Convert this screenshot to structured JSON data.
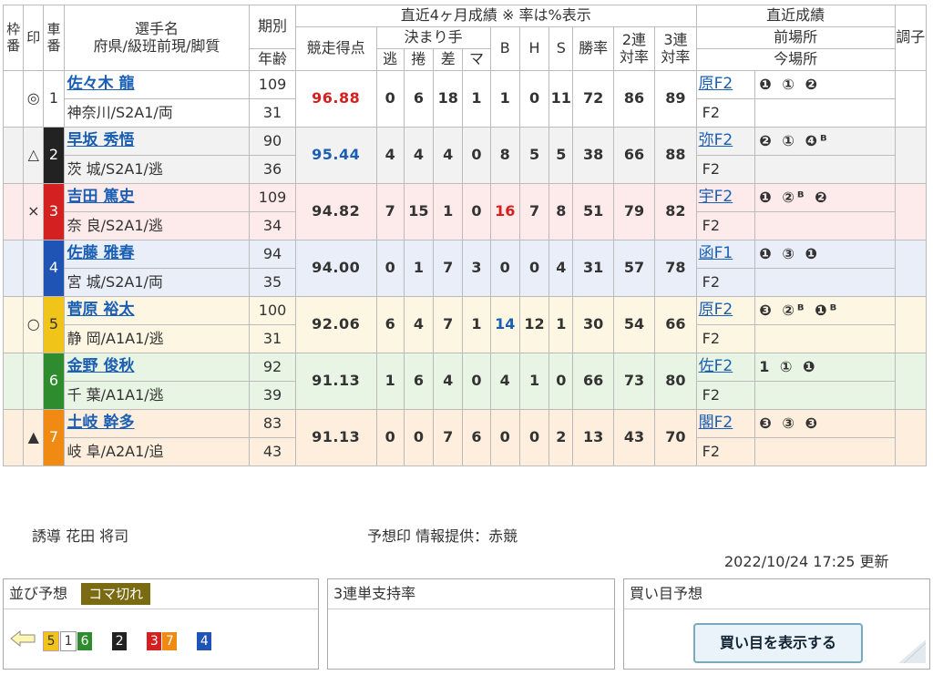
{
  "header": {
    "waku": "枠番",
    "shirushi": "印",
    "sha": "車番",
    "name1": "選手名",
    "name2": "府県/級班前現/脚質",
    "kibetsu": "期別",
    "nenrei": "年齢",
    "recent_title": "直近4ヶ月成績 ※ 率は%表示",
    "score": "競走得点",
    "kimarite": "決まり手",
    "nige": "逃",
    "makuri": "捲",
    "sashi": "差",
    "ma": "マ",
    "b": "B",
    "h": "H",
    "s": "S",
    "win": "勝率",
    "ren2": "2連\n対率",
    "ren3": "3連\n対率",
    "recent_results": "直近成績",
    "prev_venue": "前場所",
    "now_venue": "今場所",
    "chousi": "調子"
  },
  "riders": [
    {
      "mark": "◎",
      "car": "1",
      "name": "佐々木 龍",
      "info": "神奈川/S2A1/両",
      "ki": "109",
      "age": "31",
      "score": "96.88",
      "nige": "0",
      "makuri": "6",
      "sashi": "18",
      "ma": "1",
      "b": "1",
      "h": "0",
      "s": "11",
      "win": "72",
      "ren2": "86",
      "ren3": "89",
      "prev": "原F2",
      "results": "❶ ① ❷",
      "now": "F2"
    },
    {
      "mark": "△",
      "car": "2",
      "name": "早坂 秀悟",
      "info": "茨 城/S2A1/逃",
      "ki": "90",
      "age": "36",
      "score": "95.44",
      "nige": "4",
      "makuri": "4",
      "sashi": "4",
      "ma": "0",
      "b": "8",
      "h": "5",
      "s": "5",
      "win": "38",
      "ren2": "66",
      "ren3": "88",
      "prev": "弥F2",
      "results": "❷ ① ❹ᴮ",
      "now": "F2"
    },
    {
      "mark": "×",
      "car": "3",
      "name": "吉田 篤史",
      "info": "奈 良/S2A1/逃",
      "ki": "109",
      "age": "34",
      "score": "94.82",
      "nige": "7",
      "makuri": "15",
      "sashi": "1",
      "ma": "0",
      "b": "16",
      "h": "7",
      "s": "8",
      "win": "51",
      "ren2": "79",
      "ren3": "82",
      "prev": "宇F2",
      "results": "❶ ②ᴮ ❷",
      "now": "F2"
    },
    {
      "mark": "",
      "car": "4",
      "name": "佐藤 雅春",
      "info": "宮 城/S2A1/両",
      "ki": "94",
      "age": "35",
      "score": "94.00",
      "nige": "0",
      "makuri": "1",
      "sashi": "7",
      "ma": "3",
      "b": "0",
      "h": "0",
      "s": "4",
      "win": "31",
      "ren2": "57",
      "ren3": "78",
      "prev": "函F1",
      "results": "❶ ③ ❶",
      "now": "F2"
    },
    {
      "mark": "○",
      "car": "5",
      "name": "菅原 裕太",
      "info": "静 岡/A1A1/逃",
      "ki": "100",
      "age": "31",
      "score": "92.06",
      "nige": "6",
      "makuri": "4",
      "sashi": "7",
      "ma": "1",
      "b": "14",
      "h": "12",
      "s": "1",
      "win": "30",
      "ren2": "54",
      "ren3": "66",
      "prev": "原F2",
      "results": "❸ ②ᴮ ❶ᴮ",
      "now": "F2"
    },
    {
      "mark": "",
      "car": "6",
      "name": "金野 俊秋",
      "info": "千 葉/A1A1/逃",
      "ki": "92",
      "age": "39",
      "score": "91.13",
      "nige": "1",
      "makuri": "6",
      "sashi": "4",
      "ma": "0",
      "b": "4",
      "h": "1",
      "s": "0",
      "win": "66",
      "ren2": "73",
      "ren3": "80",
      "prev": "佐F2",
      "results": "1 ① ❶",
      "now": "F2"
    },
    {
      "mark": "▲",
      "car": "7",
      "name": "土岐 幹多",
      "info": "岐 阜/A2A1/追",
      "ki": "83",
      "age": "43",
      "score": "91.13",
      "nige": "0",
      "makuri": "0",
      "sashi": "7",
      "ma": "6",
      "b": "0",
      "h": "0",
      "s": "2",
      "win": "13",
      "ren2": "43",
      "ren3": "70",
      "prev": "閣F2",
      "results": "❸ ③ ❸",
      "now": "F2"
    }
  ],
  "footer": {
    "yudo": "誘導 花田 将司",
    "source": "予想印 情報提供：赤競",
    "updated": "2022/10/24 17:25 更新"
  },
  "panels": {
    "line_title": "並び予想",
    "line_tag": "コマ切れ",
    "support_title": "3連単支持率",
    "buy_title": "買い目予想",
    "buy_button": "買い目を表示する"
  },
  "colors": {
    "row_bg": [
      "#ffffff",
      "#f2f2f2",
      "#fdeaea",
      "#e9eef9",
      "#fdf6e3",
      "#e9f5e4",
      "#fdeedd"
    ],
    "car_bg": [
      "#ffffff",
      "#222222",
      "#d42020",
      "#1f54b5",
      "#f0c419",
      "#2e8b2e",
      "#f08a12"
    ],
    "score_red": "#d42020",
    "score_blue": "#1a5fb4"
  }
}
